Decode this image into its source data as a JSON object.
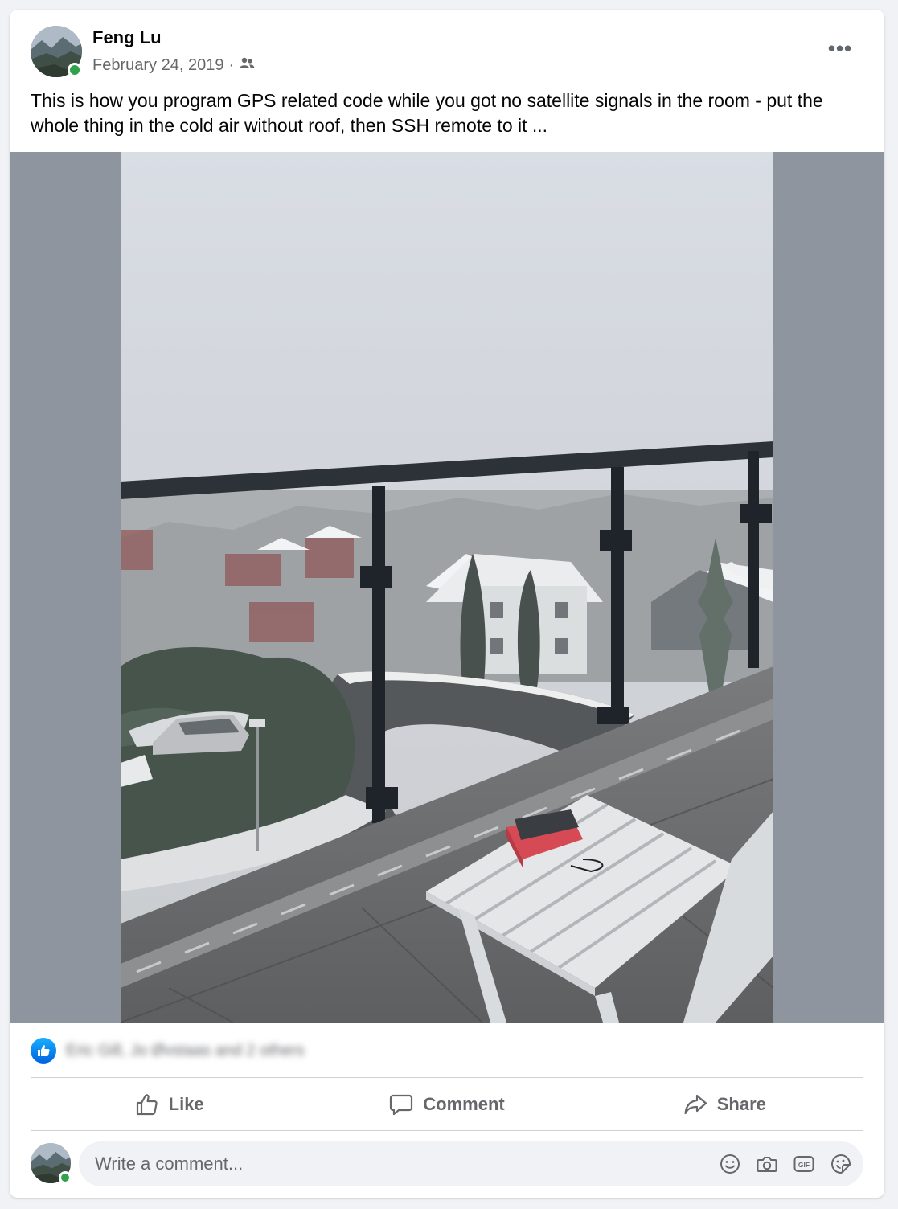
{
  "post": {
    "author": "Feng Lu",
    "date": "February 24, 2019",
    "date_separator": "·",
    "audience_icon": "friends-icon",
    "more_icon": "more-options-icon",
    "more_label": "•••",
    "text": "This is how you program GPS related code while you got no satellite signals in the room - put the whole thing in the cold air without roof, then SSH remote to it ...",
    "photo_description_icon": "photo"
  },
  "reactions": {
    "icon": "like-reaction-icon",
    "summary": "Eric Gill, Jo Øvstaas and 2 others"
  },
  "actions": {
    "like_label": "Like",
    "comment_label": "Comment",
    "share_label": "Share"
  },
  "comment_box": {
    "placeholder": "Write a comment...",
    "icons": [
      "emoji-icon",
      "camera-icon",
      "gif-icon",
      "sticker-icon"
    ],
    "gif_text": "GIF"
  },
  "colors": {
    "accent": "#1877f2",
    "secondary_text": "#65676b",
    "online": "#31a24c",
    "media_background": "#8f959e"
  }
}
